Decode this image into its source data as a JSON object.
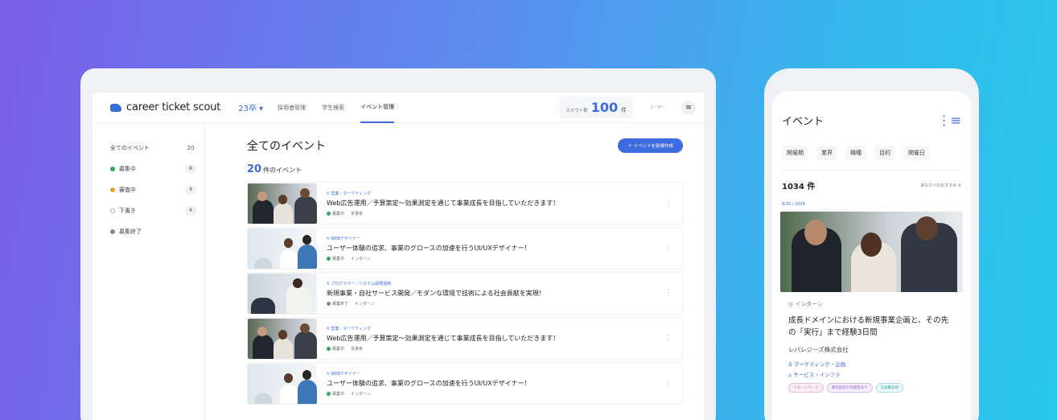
{
  "desktop": {
    "logo_text": "career ticket scout",
    "year": "23卒 ▾",
    "nav": [
      "採用者管理",
      "学生検索",
      "イベント管理"
    ],
    "count_label": "スカウト数",
    "count_num": "100",
    "count_unit": "件",
    "user_text": "ユーザー",
    "menu_icon": "≡",
    "sidebar": [
      {
        "label": "全てのイベント",
        "num": "20",
        "dot": ""
      },
      {
        "label": "募集中",
        "num": "8",
        "dot": "dot-green"
      },
      {
        "label": "審査中",
        "num": "4",
        "dot": "dot-orange"
      },
      {
        "label": "下書き",
        "num": "4",
        "dot": "dot-open"
      },
      {
        "label": "募集終了",
        "num": "",
        "dot": "dot-grey"
      }
    ],
    "main_title": "全てのイベント",
    "create_button": "＋  イベントを新規作成",
    "result_num": "20",
    "result_label": "件のイベント",
    "events": [
      {
        "category": "♁ 営業・マーケティング",
        "title": "Web広告運用／予算策定〜効果測定を通じて事業成長を目指していただきます！",
        "status": "募集中",
        "status_dot": "dot-green",
        "type": "本選考"
      },
      {
        "category": "♁ WEBデザイナー",
        "title": "ユーザー体験の追求、事業のグロースの加速を行うUI/UXデザイナー！",
        "status": "募集中",
        "status_dot": "dot-green",
        "type": "インターン"
      },
      {
        "category": "♁ プログラマー／システム開発運用",
        "title": "新規事業・自社サービス開発／モダンな環境で技術による社会貢献を実現！",
        "status": "募集終了",
        "status_dot": "dot-grey",
        "type": "インターン"
      },
      {
        "category": "♁ 営業・マーケティング",
        "title": "Web広告運用／予算策定〜効果測定を通じて事業成長を目指していただきます！",
        "status": "募集中",
        "status_dot": "dot-green",
        "type": "本選考"
      },
      {
        "category": "♁ WEBデザイナー",
        "title": "ユーザー体験の追求、事業のグロースの加速を行うUI/UXデザイナー！",
        "status": "募集中",
        "status_dot": "dot-green",
        "type": "インターン"
      }
    ]
  },
  "phone": {
    "title": "イベント",
    "filter_icon": "⋮≡",
    "tabs": [
      "開催期",
      "業界",
      "職種",
      "目的",
      "開催日"
    ],
    "count": "1034 件",
    "sort": "あなたへのおすすめ ⇅",
    "date": "8/20 / 2024",
    "type": "◎ インターン",
    "card_title": "成長ドメインにおける新規事業企画と、その先の「実行」まで経験3日間",
    "company": "レバレジーズ株式会社",
    "tag1": "♁ マーケティング・企画",
    "tag2": "⌂ サービス・インフラ",
    "chips": [
      "リモートワーク",
      "選考直結の可能性あり",
      "交通費支給"
    ]
  },
  "colors": {
    "accent": "#3d6be0",
    "green": "#2eaa55",
    "orange": "#f0a020"
  }
}
